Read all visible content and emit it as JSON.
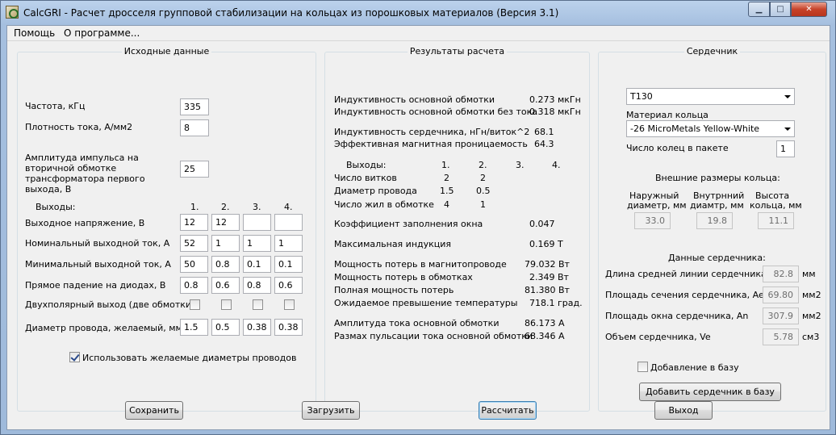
{
  "window": {
    "title": "CalcGRI - Расчет дросселя групповой стабилизации на кольцах из порошковых материалов (Версия 3.1)",
    "minimize_glyph": "▁",
    "maximize_glyph": "□",
    "close_glyph": "✕"
  },
  "menu": {
    "help": "Помощь",
    "about": "О программе..."
  },
  "input_group": {
    "title": "Исходные данные",
    "frequency_label": "Частота, кГц",
    "frequency_value": "335",
    "current_density_label": "Плотность тока, А/мм2",
    "current_density_value": "8",
    "amplitude_label": "Амплитуда импульса на вторичной обмотке трансформатора первого выхода, В",
    "amplitude_value": "25",
    "outputs_label": "Выходы:",
    "output_headers": [
      "1.",
      "2.",
      "3.",
      "4."
    ],
    "voltage_label": "Выходное напряжение, В",
    "voltage_values": [
      "12",
      "12",
      "",
      ""
    ],
    "nominal_current_label": "Номинальный выходной ток, А",
    "nominal_current_values": [
      "52",
      "1",
      "1",
      "1"
    ],
    "min_current_label": "Минимальный выходной ток, А",
    "min_current_values": [
      "50",
      "0.8",
      "0.1",
      "0.1"
    ],
    "diode_drop_label": "Прямое падение на диодах, В",
    "diode_drop_values": [
      "0.8",
      "0.6",
      "0.8",
      "0.6"
    ],
    "bipolar_label": "Двухполярный выход (две обмотки)",
    "bipolar_checked": [
      false,
      false,
      false,
      false
    ],
    "wire_diam_label": "Диаметр провода, желаемый, мм",
    "wire_diam_values": [
      "1.5",
      "0.5",
      "0.38",
      "0.38"
    ],
    "use_desired_label": "Использовать желаемые диаметры проводов",
    "use_desired_checked": true
  },
  "results_group": {
    "title": "Результаты расчета",
    "rows_top": [
      {
        "label": "Индуктивность основной обмотки",
        "value": "0.273 мкГн"
      },
      {
        "label": "Индуктивность основной обмотки без тока",
        "value": "0.318 мкГн"
      },
      {
        "label": "Индуктивность сердечника, нГн/виток^2",
        "value": "68.1"
      },
      {
        "label": "Эффективная магнитная проницаемость",
        "value": "64.3"
      }
    ],
    "outputs_label": "Выходы:",
    "output_headers": [
      "1.",
      "2.",
      "3.",
      "4."
    ],
    "turns_label": "Число витков",
    "turns_values": [
      "2",
      "2",
      "",
      ""
    ],
    "wire_diam_label": "Диаметр провода",
    "wire_diam_values": [
      "1.5",
      "0.5",
      "",
      ""
    ],
    "strands_label": "Число жил в обмотке",
    "strands_values": [
      "4",
      "1",
      "",
      ""
    ],
    "rows_bottom": [
      {
        "label": "Коэффициент заполнения окна",
        "value": "0.047"
      },
      {
        "label": "Максимальная индукция",
        "value": "0.169 Т"
      },
      {
        "label": "Мощность потерь в магнитопроводе",
        "value": "79.032 Вт"
      },
      {
        "label": "Мощность потерь в обмотках",
        "value": "2.349 Вт"
      },
      {
        "label": "Полная мощность потерь",
        "value": "81.380 Вт"
      },
      {
        "label": "Ожидаемое превышение температуры",
        "value": "718.1 град."
      },
      {
        "label": "Амплитуда тока основной обмотки",
        "value": "86.173 А"
      },
      {
        "label": "Размах пульсации тока основной обмотки",
        "value": "68.346 А"
      }
    ]
  },
  "core_group": {
    "title": "Сердечник",
    "core_selected": "T130",
    "material_label": "Материал кольца",
    "material_selected": "-26 MicroMetals Yellow-White",
    "rings_label": "Число колец в пакете",
    "rings_value": "1",
    "outer_dims_label": "Внешние размеры кольца:",
    "outer_diam_label_1": "Наружный",
    "outer_diam_label_2": "диаметр, мм",
    "inner_diam_label_1": "Внутрнний",
    "inner_diam_label_2": "диамтр, мм",
    "height_label_1": "Высота",
    "height_label_2": "кольца, мм",
    "outer_diam_value": "33.0",
    "inner_diam_value": "19.8",
    "height_value": "11.1",
    "core_data_label": "Данные сердечника:",
    "path_length_label": "Длина средней линии сердечника, le",
    "path_length_value": "82.8",
    "path_length_unit": "мм",
    "cross_section_label": "Площадь сечения сердечника, Ae",
    "cross_section_value": "69.80",
    "cross_section_unit": "мм2",
    "window_area_label": "Площадь окна сердечника, An",
    "window_area_value": "307.9",
    "window_area_unit": "мм2",
    "volume_label": "Объем сердечника, Ve",
    "volume_value": "5.78",
    "volume_unit": "см3",
    "add_to_db_label": "Добавление в базу",
    "add_to_db_checked": false,
    "add_core_button": "Добавить сердечник в базу"
  },
  "buttons": {
    "save": "Сохранить",
    "load": "Загрузить",
    "calculate": "Рассчитать",
    "exit": "Выход"
  }
}
